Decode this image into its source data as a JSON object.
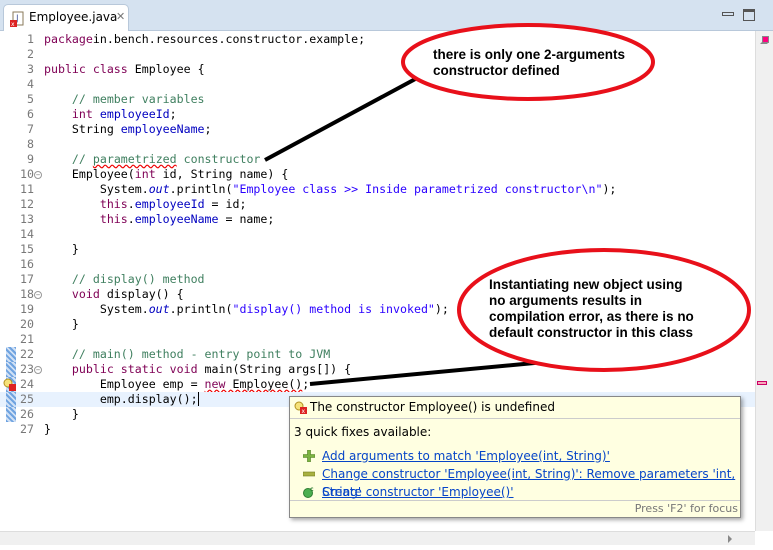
{
  "tab": {
    "title": "Employee.java",
    "close": "✕"
  },
  "colors": {
    "keyword": "#7f0055",
    "comment": "#3f7f5f",
    "field": "#0000c0",
    "string": "#2a00ff",
    "annotation_ellipse": "#e8101a",
    "error_marker": "#ff0080"
  },
  "code": [
    {
      "n": "1",
      "t": [
        [
          "kw",
          "package"
        ],
        [
          "",
          "in.bench.resources.constructor.example;"
        ]
      ]
    },
    {
      "n": "2",
      "t": []
    },
    {
      "n": "3",
      "t": [
        [
          "kw",
          "public class"
        ],
        [
          "",
          " Employee {"
        ]
      ]
    },
    {
      "n": "4",
      "t": []
    },
    {
      "n": "5",
      "t": [
        [
          "",
          "    "
        ],
        [
          "cm",
          "// member variables"
        ]
      ]
    },
    {
      "n": "6",
      "t": [
        [
          "",
          "    "
        ],
        [
          "kw",
          "int"
        ],
        [
          "",
          " "
        ],
        [
          "fd",
          "employeeId"
        ],
        [
          "",
          ";"
        ]
      ]
    },
    {
      "n": "7",
      "t": [
        [
          "",
          "    String "
        ],
        [
          "fd",
          "employeeName"
        ],
        [
          "",
          ";"
        ]
      ]
    },
    {
      "n": "8",
      "t": []
    },
    {
      "n": "9",
      "t": [
        [
          "",
          "    "
        ],
        [
          "cm",
          "// "
        ],
        [
          "cm err",
          "parametrized"
        ],
        [
          "cm",
          " constructor"
        ]
      ]
    },
    {
      "n": "10",
      "fold": true,
      "t": [
        [
          "",
          "    Employee("
        ],
        [
          "kw",
          "int"
        ],
        [
          "",
          " id, String name) {"
        ]
      ]
    },
    {
      "n": "11",
      "t": [
        [
          "",
          "        System."
        ],
        [
          "fd it",
          "out"
        ],
        [
          "",
          ".println("
        ],
        [
          "st",
          "\"Employee class >> Inside parametrized constructor\\n\""
        ],
        [
          "",
          ");"
        ]
      ]
    },
    {
      "n": "12",
      "t": [
        [
          "",
          "        "
        ],
        [
          "kw",
          "this"
        ],
        [
          "",
          "."
        ],
        [
          "fd",
          "employeeId"
        ],
        [
          "",
          " = id;"
        ]
      ]
    },
    {
      "n": "13",
      "t": [
        [
          "",
          "        "
        ],
        [
          "kw",
          "this"
        ],
        [
          "",
          "."
        ],
        [
          "fd",
          "employeeName"
        ],
        [
          "",
          " = name;"
        ]
      ]
    },
    {
      "n": "14",
      "t": []
    },
    {
      "n": "15",
      "t": [
        [
          "",
          "    }"
        ]
      ]
    },
    {
      "n": "16",
      "t": []
    },
    {
      "n": "17",
      "t": [
        [
          "",
          "    "
        ],
        [
          "cm",
          "// display() method"
        ]
      ]
    },
    {
      "n": "18",
      "fold": true,
      "t": [
        [
          "",
          "    "
        ],
        [
          "kw",
          "void"
        ],
        [
          "",
          " display() {"
        ]
      ]
    },
    {
      "n": "19",
      "t": [
        [
          "",
          "        System."
        ],
        [
          "fd it",
          "out"
        ],
        [
          "",
          ".println("
        ],
        [
          "st",
          "\"display() method is invoked\""
        ],
        [
          "",
          ");"
        ]
      ]
    },
    {
      "n": "20",
      "t": [
        [
          "",
          "    }"
        ]
      ]
    },
    {
      "n": "21",
      "t": []
    },
    {
      "n": "22",
      "mark": true,
      "t": [
        [
          "",
          "    "
        ],
        [
          "cm",
          "// main() method - entry point to JVM"
        ]
      ]
    },
    {
      "n": "23",
      "mark": true,
      "fold": true,
      "t": [
        [
          "",
          "    "
        ],
        [
          "kw",
          "public static void"
        ],
        [
          "",
          " main(String args[]) {"
        ]
      ]
    },
    {
      "n": "24",
      "mark": true,
      "error": true,
      "t": [
        [
          "",
          "        Employee emp = "
        ],
        [
          "kw err",
          "new"
        ],
        [
          "err",
          " Employee()"
        ],
        [
          "",
          ";"
        ]
      ]
    },
    {
      "n": "25",
      "mark": true,
      "current": true,
      "t": [
        [
          "",
          "        emp.display();|"
        ]
      ]
    },
    {
      "n": "26",
      "mark": true,
      "t": [
        [
          "",
          "    }"
        ]
      ]
    },
    {
      "n": "27",
      "t": [
        [
          "",
          "}"
        ]
      ]
    }
  ],
  "annotations": [
    {
      "lines": [
        "there is only one 2-arguments",
        "constructor defined"
      ]
    },
    {
      "lines": [
        "Instantiating new object using",
        "no arguments results in",
        "compilation error, as there is no",
        "default constructor in this class"
      ]
    }
  ],
  "popup": {
    "title": "The constructor Employee() is undefined",
    "count": "3 quick fixes available:",
    "fixes": [
      {
        "icon": "add-icon",
        "label": "Add arguments to match 'Employee(int, String)'"
      },
      {
        "icon": "remove-icon",
        "label": "Change constructor 'Employee(int, String)': Remove parameters 'int, String'"
      },
      {
        "icon": "create-constructor-icon",
        "label": "Create constructor 'Employee()'"
      }
    ],
    "footer": "Press 'F2' for focus"
  }
}
